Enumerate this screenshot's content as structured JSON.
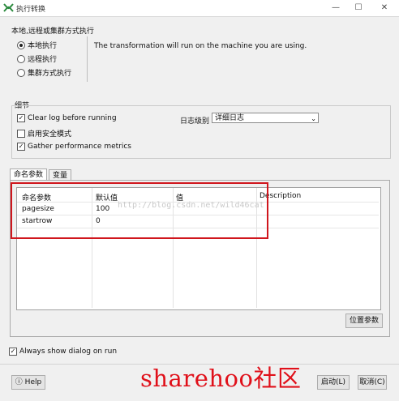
{
  "window": {
    "title": "执行转换",
    "minimize_glyph": "—",
    "maximize_glyph": "☐",
    "close_glyph": "✕"
  },
  "execution": {
    "group_label": "本地,远程或集群方式执行",
    "options": [
      {
        "label": "本地执行",
        "selected": true
      },
      {
        "label": "远程执行",
        "selected": false
      },
      {
        "label": "集群方式执行",
        "selected": false
      }
    ],
    "description": "The transformation will run on the machine you are using."
  },
  "details": {
    "group_label": "细节",
    "clear_log": {
      "label": "Clear log before running",
      "checked": true
    },
    "safe_mode": {
      "label": "启用安全模式",
      "checked": false
    },
    "gather_metrics": {
      "label": "Gather performance metrics",
      "checked": true
    },
    "log_level_label": "日志级别",
    "log_level_value": "详细日志"
  },
  "tabs": [
    {
      "label": "命名参数",
      "active": true
    },
    {
      "label": "变量",
      "active": false
    }
  ],
  "params_table": {
    "columns": [
      "命名参数",
      "默认值",
      "值",
      "Description"
    ],
    "rows": [
      {
        "name": "pagesize",
        "default": "100",
        "value": "",
        "description": ""
      },
      {
        "name": "startrow",
        "default": "0",
        "value": "",
        "description": ""
      }
    ]
  },
  "buttons": {
    "position_params": "位置参数",
    "help": "Help",
    "launch": "启动(L)",
    "cancel": "取消(C)"
  },
  "always_show": {
    "label": "Always show dialog on run",
    "checked": true
  },
  "watermark_text": "http://blog.csdn.net/wild46cat",
  "overlay_text": "sharehoo社区",
  "colors": {
    "highlight_box": "#d0161d",
    "overlay_text": "#e0101a"
  }
}
